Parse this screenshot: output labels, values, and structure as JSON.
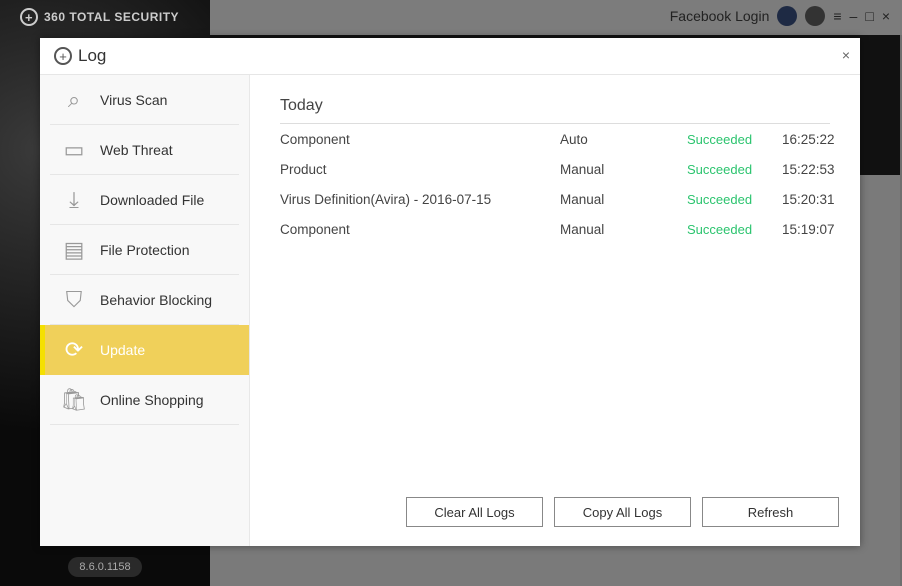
{
  "app": {
    "brand": "360 TOTAL SECURITY",
    "facebook_login": "Facebook Login",
    "version": "8.6.0.1158"
  },
  "dialog": {
    "title": "Log",
    "close": "×"
  },
  "sidebar": {
    "items": [
      {
        "label": "Virus Scan",
        "icon": "virus-scan-icon"
      },
      {
        "label": "Web Threat",
        "icon": "web-threat-icon"
      },
      {
        "label": "Downloaded File",
        "icon": "download-icon"
      },
      {
        "label": "File Protection",
        "icon": "document-icon"
      },
      {
        "label": "Behavior Blocking",
        "icon": "shield-window-icon"
      },
      {
        "label": "Update",
        "icon": "refresh-icon",
        "active": true
      },
      {
        "label": "Online Shopping",
        "icon": "shopping-bag-icon"
      }
    ]
  },
  "log": {
    "section": "Today",
    "rows": [
      {
        "name": "Component",
        "mode": "Auto",
        "status": "Succeeded",
        "time": "16:25:22"
      },
      {
        "name": "Product",
        "mode": "Manual",
        "status": "Succeeded",
        "time": "15:22:53"
      },
      {
        "name": "Virus Definition(Avira) - 2016-07-15",
        "mode": "Manual",
        "status": "Succeeded",
        "time": "15:20:31"
      },
      {
        "name": "Component",
        "mode": "Manual",
        "status": "Succeeded",
        "time": "15:19:07"
      }
    ]
  },
  "buttons": {
    "clear": "Clear All Logs",
    "copy": "Copy All Logs",
    "refresh": "Refresh"
  },
  "colors": {
    "accent": "#f0d05a",
    "success": "#2bc46e"
  }
}
